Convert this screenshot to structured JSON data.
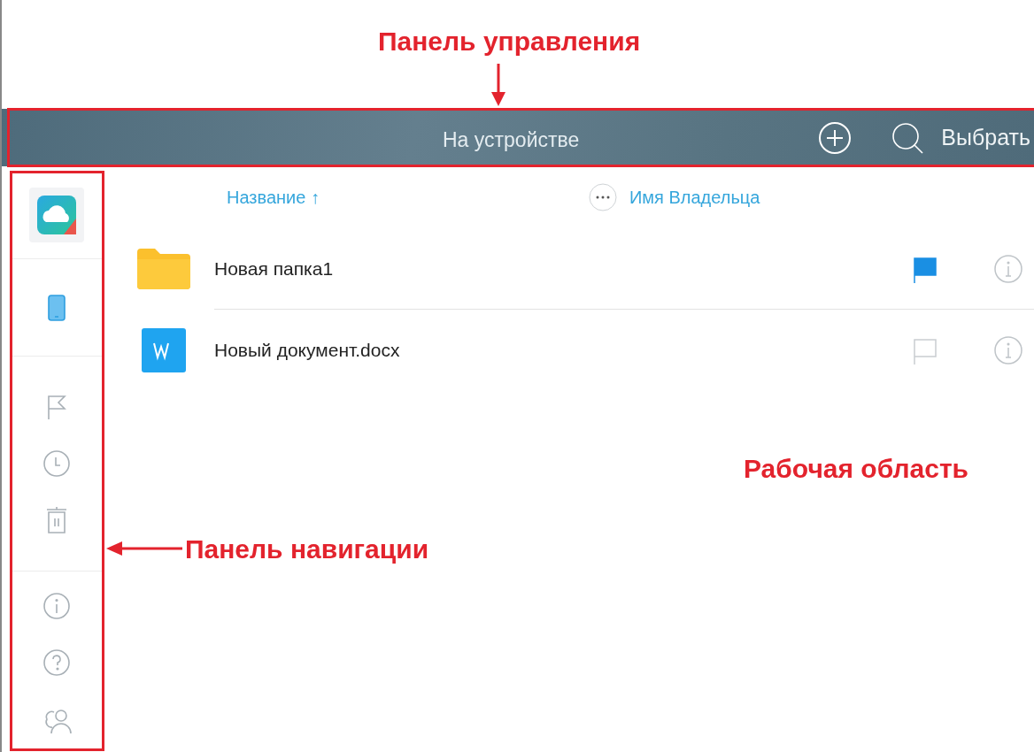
{
  "annotations": [
    {
      "text": "Панель управления"
    },
    {
      "text": "Панель навигации"
    },
    {
      "text": "Рабочая область"
    }
  ],
  "toolbar": {
    "title": "На устройстве",
    "select_button": "Выбрать"
  },
  "sidebar": {
    "items": [
      {
        "selected": true
      },
      {
        "selected": false
      },
      {
        "selected": false
      },
      {
        "selected": false
      },
      {
        "selected": false
      },
      {
        "selected": false
      },
      {
        "selected": false
      }
    ]
  },
  "columns": [
    {
      "label": "Название ↑"
    },
    {
      "label": "Имя Владельца"
    }
  ],
  "files": [
    {
      "name": "Новая папка1",
      "kind": "folder",
      "flagged": true
    },
    {
      "name": "Новый документ.docx",
      "kind": "document",
      "flagged": false
    }
  ]
}
